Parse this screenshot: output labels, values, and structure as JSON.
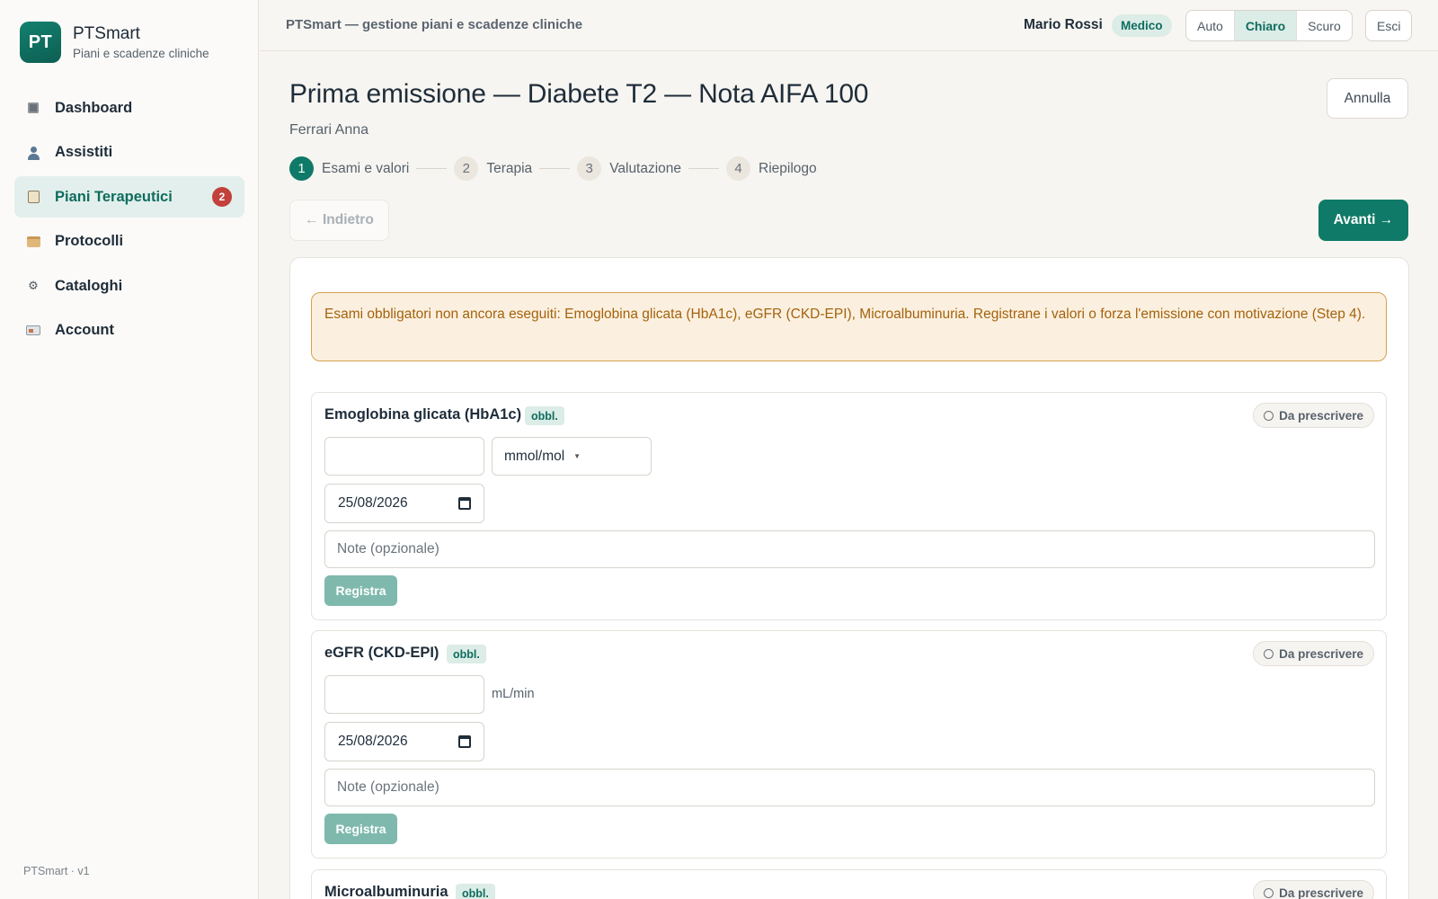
{
  "brand": {
    "logo": "PT",
    "name": "PTSmart",
    "subtitle": "Piani e scadenze cliniche"
  },
  "sidebar": {
    "items": [
      {
        "label": "Dashboard",
        "icon": "dashboard-icon"
      },
      {
        "label": "Assistiti",
        "icon": "user-icon"
      },
      {
        "label": "Piani Terapeutici",
        "icon": "document-icon",
        "badge": "2",
        "active": true
      },
      {
        "label": "Protocolli",
        "icon": "box-icon"
      },
      {
        "label": "Cataloghi",
        "icon": "gear-icon",
        "glyph": "⚙"
      },
      {
        "label": "Account",
        "icon": "id-card-icon"
      }
    ],
    "footer": "PTSmart · v1"
  },
  "topbar": {
    "title": "PTSmart — gestione piani e scadenze cliniche",
    "user": "Mario Rossi",
    "role": "Medico",
    "themes": [
      "Auto",
      "Chiaro",
      "Scuro"
    ],
    "active_theme": "Chiaro",
    "logout": "Esci"
  },
  "page": {
    "title": "Prima emissione — Diabete T2 — Nota AIFA 100",
    "patient": "Ferrari Anna",
    "cancel": "Annulla",
    "back": "← Indietro",
    "next": "Avanti →"
  },
  "steps": [
    {
      "num": "1",
      "label": "Esami e valori",
      "active": true
    },
    {
      "num": "2",
      "label": "Terapia"
    },
    {
      "num": "3",
      "label": "Valutazione"
    },
    {
      "num": "4",
      "label": "Riepilogo"
    }
  ],
  "alert": "Esami obbligatori non ancora eseguiti: Emoglobina glicata (HbA1c), eGFR (CKD-EPI), Microalbuminuria. Registrane i valori o forza l'emissione con motivazione (Step 4).",
  "exams": [
    {
      "name": "Emoglobina glicata (HbA1c)",
      "required": "obbl.",
      "status": "Da prescrivere",
      "value": "",
      "unit": "mmol/mol",
      "unit_is_select": true,
      "date": "25/08/2026",
      "note_placeholder": "Note (opzionale)",
      "register": "Registra"
    },
    {
      "name": "eGFR (CKD-EPI)",
      "required": "obbl.",
      "status": "Da prescrivere",
      "value": "",
      "unit": "mL/min",
      "unit_is_select": false,
      "date": "25/08/2026",
      "note_placeholder": "Note (opzionale)",
      "register": "Registra"
    },
    {
      "name": "Microalbuminuria",
      "required": "obbl.",
      "status": "Da prescrivere"
    }
  ],
  "colors": {
    "accent": "#0f7a67",
    "accent_light": "#dcece7",
    "danger": "#c2413b",
    "warning_bg": "#fbf0df",
    "warning_border": "#d6a14e",
    "warning_text": "#a4620d"
  }
}
